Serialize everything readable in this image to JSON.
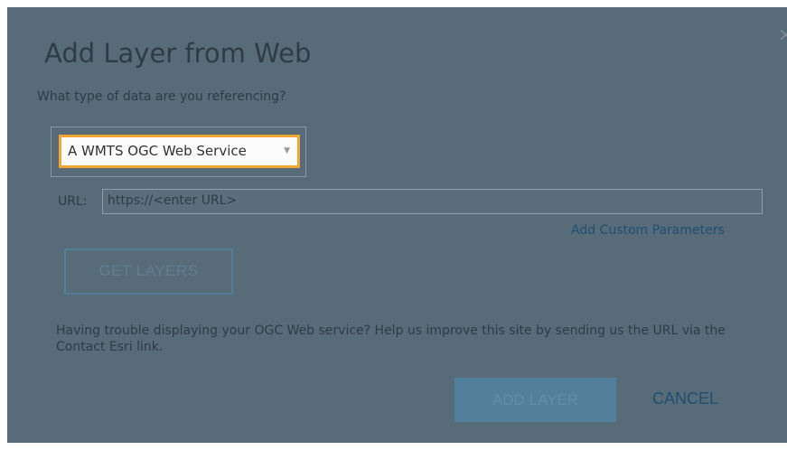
{
  "dialog": {
    "title": "Add Layer from Web",
    "close_glyph": "×",
    "question": "What type of data are you referencing?",
    "data_type_select": {
      "value": "A WMTS OGC Web Service",
      "arrow_glyph": "▼"
    },
    "url": {
      "label": "URL:",
      "value": "https://<enter URL>"
    },
    "custom_parameters_link": "Add Custom Parameters",
    "get_layers_button": "GET LAYERS",
    "help_text": "Having trouble displaying your OGC Web service? Help us improve this site by sending us the URL via the Contact Esri link.",
    "add_layer_button": "ADD LAYER",
    "cancel_button": "CANCEL"
  },
  "colors": {
    "dialog_background": "#586b78",
    "select_focus_border": "#f2a533",
    "link": "#1f4f72"
  }
}
